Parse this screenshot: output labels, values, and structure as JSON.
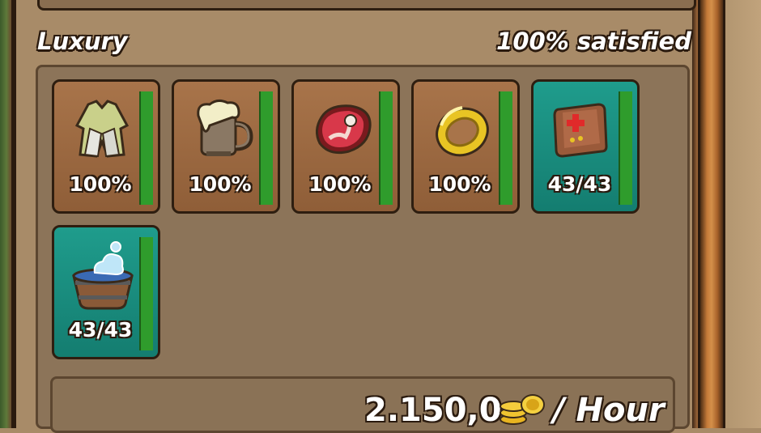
{
  "section": {
    "title": "Luxury",
    "status": "100% satisfied"
  },
  "goods": [
    {
      "icon": "clothes-icon",
      "value": "100%",
      "style": "brown"
    },
    {
      "icon": "beer-mug-icon",
      "value": "100%",
      "style": "brown"
    },
    {
      "icon": "meat-icon",
      "value": "100%",
      "style": "brown"
    },
    {
      "icon": "gold-ring-icon",
      "value": "100%",
      "style": "brown"
    },
    {
      "icon": "first-aid-kit-icon",
      "value": "43/43",
      "style": "teal"
    },
    {
      "icon": "bath-tub-icon",
      "value": "43/43",
      "style": "teal"
    }
  ],
  "income": {
    "value": "2.150,0",
    "icon": "gold-coins-icon",
    "unit": "/ Hour"
  },
  "colors": {
    "brown_tile": "#a8744a",
    "teal_tile": "#1f9c8c",
    "bar_green": "#2f9c2c",
    "panel": "#8c7459"
  }
}
